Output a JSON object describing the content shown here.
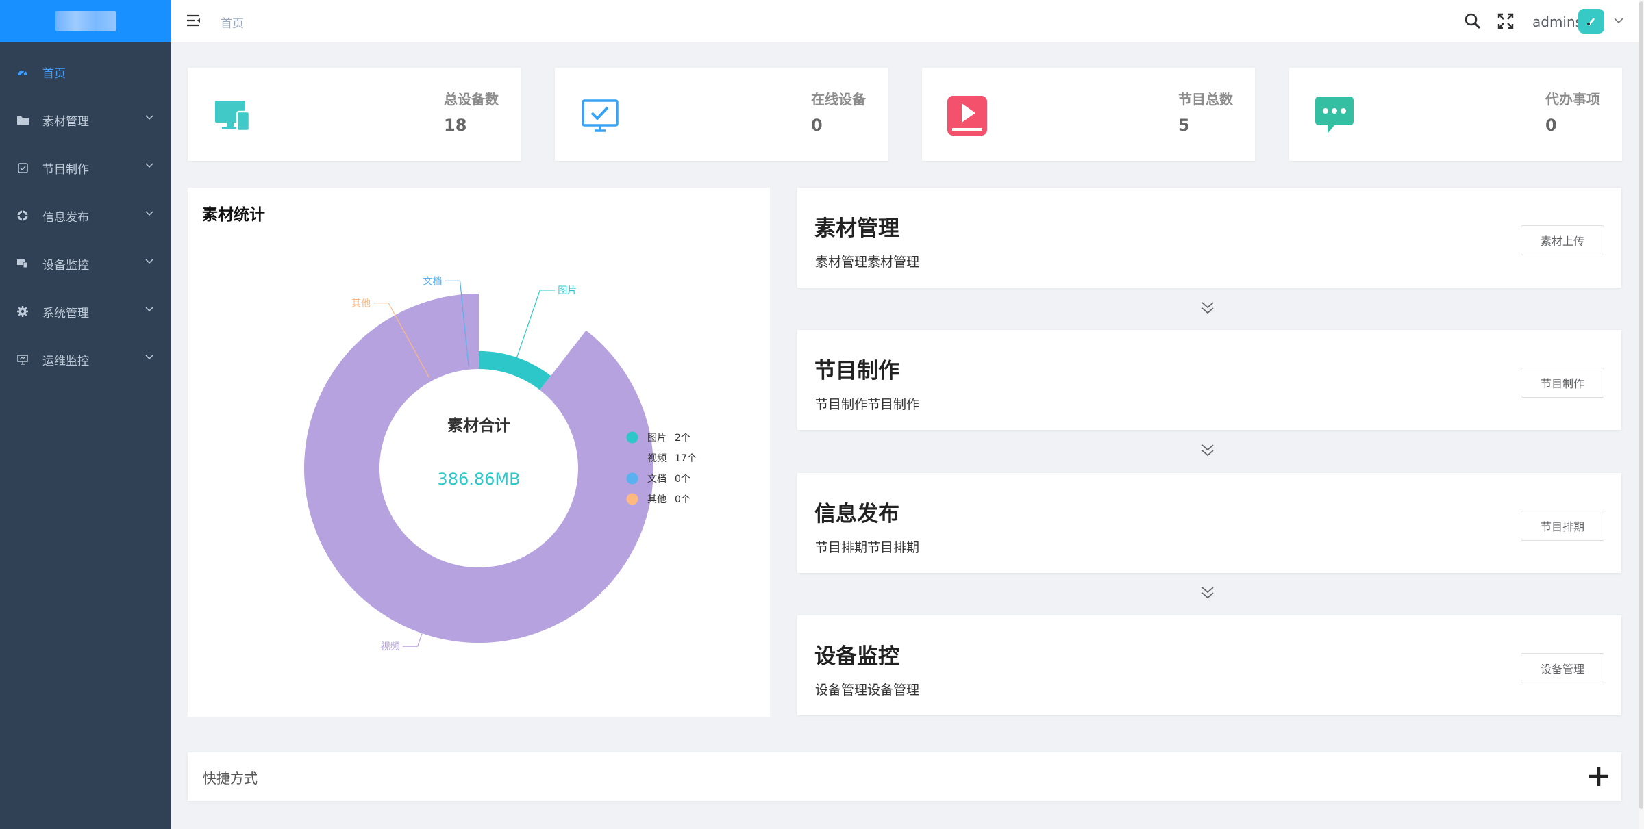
{
  "sidebar": {
    "items": [
      {
        "label": "首页",
        "icon": "dashboard-icon",
        "active": true
      },
      {
        "label": "素材管理",
        "icon": "folder-icon"
      },
      {
        "label": "节目制作",
        "icon": "checkbox-icon"
      },
      {
        "label": "信息发布",
        "icon": "publish-icon"
      },
      {
        "label": "设备监控",
        "icon": "monitor-devices-icon"
      },
      {
        "label": "系统管理",
        "icon": "gear-icon"
      },
      {
        "label": "运维监控",
        "icon": "screen-icon"
      }
    ]
  },
  "header": {
    "breadcrumb": "首页",
    "user": "admins"
  },
  "stats": [
    {
      "label": "总设备数",
      "value": "18",
      "icon": "devices-icon",
      "color": "#40c9c6"
    },
    {
      "label": "在线设备",
      "value": "0",
      "icon": "monitor-check-icon",
      "color": "#36a3f7"
    },
    {
      "label": "节目总数",
      "value": "5",
      "icon": "play-icon",
      "color": "#f4516c"
    },
    {
      "label": "代办事项",
      "value": "0",
      "icon": "message-icon",
      "color": "#34bfa3"
    }
  ],
  "material_panel": {
    "title": "素材统计",
    "center_title": "素材合计",
    "center_value": "386.86MB"
  },
  "chart_data": {
    "type": "pie",
    "donut": true,
    "rose": true,
    "title": "素材统计",
    "categories": [
      "图片",
      "视频",
      "文档",
      "其他"
    ],
    "values": [
      2,
      17,
      0,
      0
    ],
    "value_labels": [
      "2个",
      "17个",
      "0个",
      "0个"
    ],
    "colors": [
      "#2ec7c9",
      "#b6a2de",
      "#5ab1ef",
      "#ffb980"
    ],
    "legend": "right"
  },
  "workflow": [
    {
      "title": "素材管理",
      "desc": "素材管理素材管理",
      "button": "素材上传"
    },
    {
      "title": "节目制作",
      "desc": "节目制作节目制作",
      "button": "节目制作"
    },
    {
      "title": "信息发布",
      "desc": "节目排期节目排期",
      "button": "节目排期"
    },
    {
      "title": "设备监控",
      "desc": "设备管理设备管理",
      "button": "设备管理"
    }
  ],
  "shortcut": {
    "label": "快捷方式"
  }
}
